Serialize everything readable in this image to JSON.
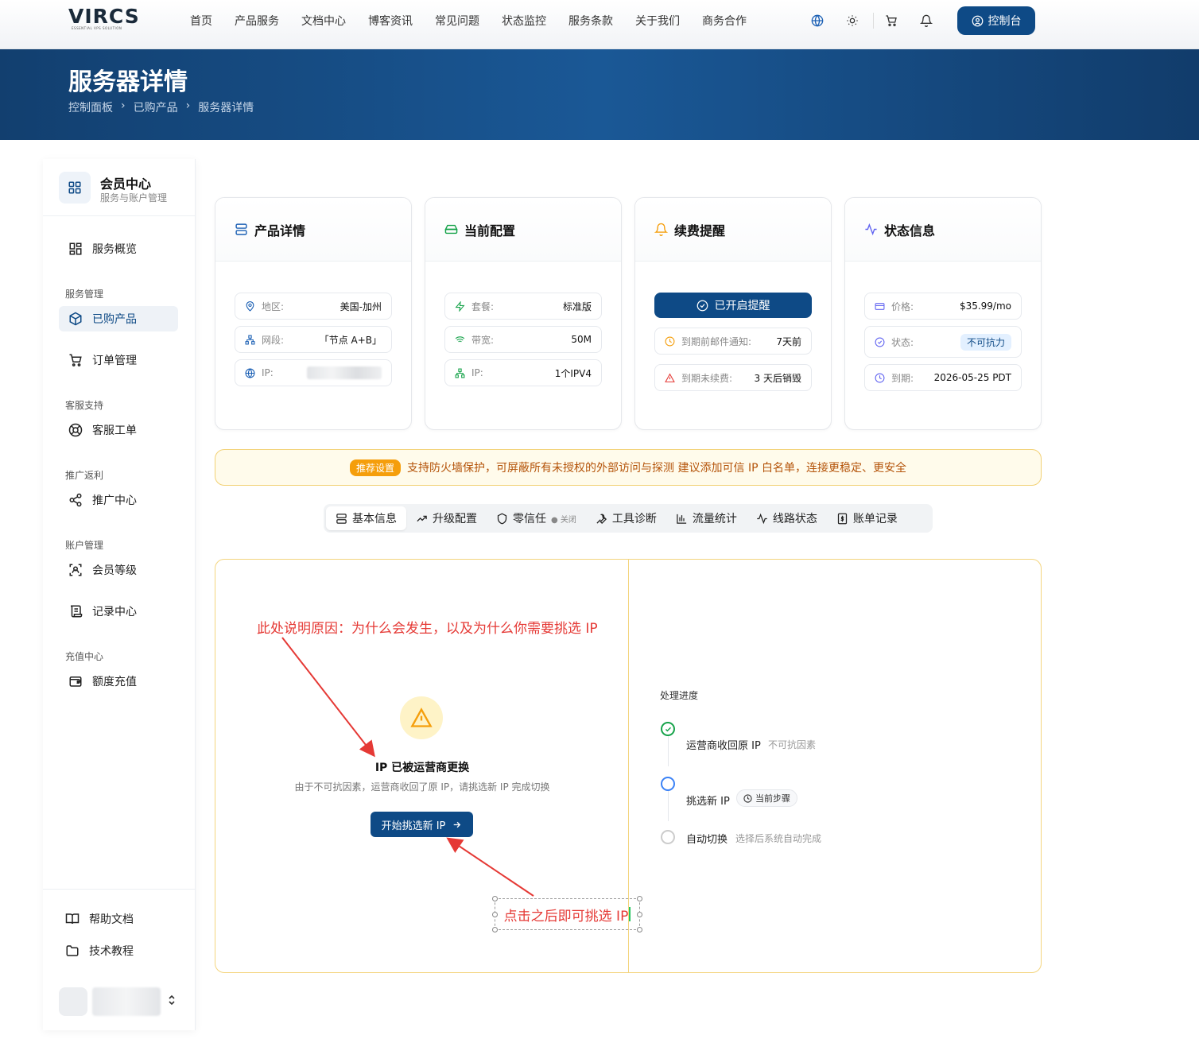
{
  "brand": {
    "logo_text": "VIRCS",
    "logo_sub": "ESSENTIAL VPS SOLUTION"
  },
  "nav": {
    "links": [
      "首页",
      "产品服务",
      "文档中心",
      "博客资讯",
      "常见问题",
      "状态监控",
      "服务条款",
      "关于我们",
      "商务合作"
    ],
    "console_label": "控制台"
  },
  "header": {
    "title": "服务器详情",
    "breadcrumb": [
      "控制面板",
      "已购产品",
      "服务器详情"
    ]
  },
  "sidebar": {
    "title": "会员中心",
    "subtitle": "服务与账户管理",
    "overview": "服务概览",
    "sections": {
      "service": "服务管理",
      "support": "客服支持",
      "promo": "推广返利",
      "account": "账户管理",
      "recharge": "充值中心"
    },
    "items": {
      "purchased": "已购产品",
      "orders": "订单管理",
      "tickets": "客服工单",
      "promotion": "推广中心",
      "level": "会员等级",
      "records": "记录中心",
      "credit": "额度充值"
    },
    "footer": {
      "help": "帮助文档",
      "tutorial": "技术教程"
    }
  },
  "cards": {
    "product": {
      "title": "产品详情",
      "region_label": "地区:",
      "region": "美国-加州",
      "segment_label": "网段:",
      "segment": "「节点 A+B」",
      "ip_label": "IP:"
    },
    "config": {
      "title": "当前配置",
      "plan_label": "套餐:",
      "plan": "标准版",
      "bandwidth_label": "带宽:",
      "bandwidth": "50M",
      "ip_label": "IP:",
      "ip": "1个IPV4"
    },
    "renewal": {
      "title": "续费提醒",
      "button": "已开启提醒",
      "notify_label": "到期前邮件通知:",
      "notify": "7天前",
      "expire_label": "到期未续费:",
      "expire": "3 天后销毁"
    },
    "status": {
      "title": "状态信息",
      "price_label": "价格:",
      "price": "$35.99/mo",
      "state_label": "状态:",
      "state": "不可抗力",
      "due_label": "到期:",
      "due": "2026-05-25 PDT"
    }
  },
  "notice": {
    "tag": "推荐设置",
    "text": "支持防火墙保护，可屏蔽所有未授权的外部访问与探测  建议添加可信 IP 白名单，连接更稳定、更安全"
  },
  "tabs": {
    "basic": "基本信息",
    "upgrade": "升级配置",
    "zerotrust": "零信任",
    "zerotrust_state": "关闭",
    "tools": "工具诊断",
    "traffic": "流量统计",
    "route": "线路状态",
    "billing": "账单记录"
  },
  "panel": {
    "annotation_reason": "此处说明原因：为什么会发生，以及为什么你需要挑选 IP",
    "title": "IP 已被运营商更换",
    "desc": "由于不可抗因素，运营商收回了原 IP，请挑选新 IP 完成切换",
    "start_button": "开始挑选新 IP",
    "annotation_click": "点击之后即可挑选 IP",
    "progress_title": "处理进度",
    "steps": [
      {
        "name": "运营商收回原 IP",
        "note": "不可抗因素"
      },
      {
        "name": "挑选新 IP",
        "tag": "当前步骤"
      },
      {
        "name": "自动切换",
        "note": "选择后系统自动完成"
      }
    ]
  },
  "colors": {
    "primary": "#0e4a86",
    "warning": "#f59e0b",
    "annotation": "#e53935",
    "success": "#16a34a"
  }
}
